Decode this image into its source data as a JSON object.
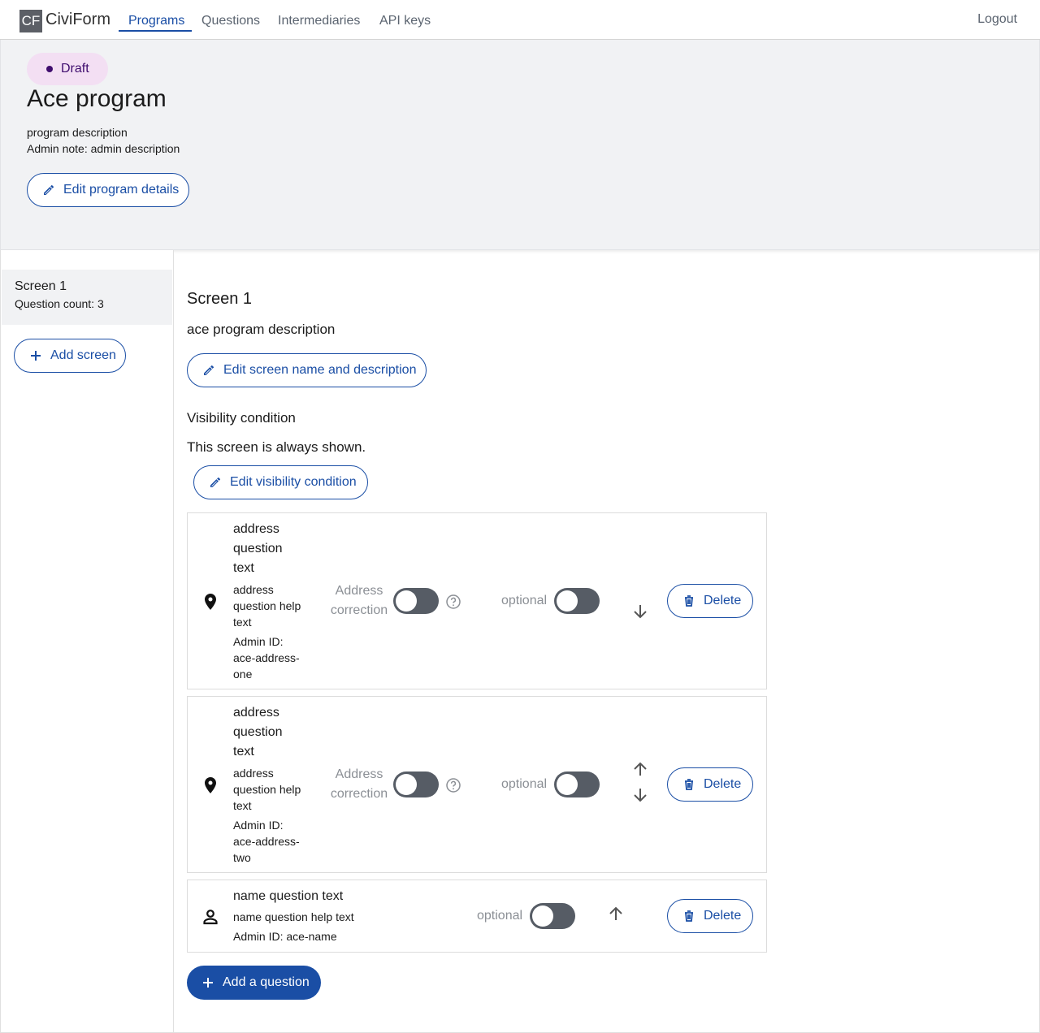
{
  "nav": {
    "logo_abbr": "CF",
    "brand": "CiviForm",
    "links": [
      "Programs",
      "Questions",
      "Intermediaries",
      "API keys"
    ],
    "active": "Programs",
    "logout": "Logout"
  },
  "program": {
    "status": "Draft",
    "title": "Ace program",
    "description": "program description",
    "admin_note": "Admin note: admin description",
    "edit_button": "Edit program details"
  },
  "sidebar": {
    "screens": [
      {
        "title": "Screen 1",
        "count": "Question count: 3"
      }
    ],
    "add_screen": "Add screen"
  },
  "screen": {
    "title": "Screen 1",
    "description": "ace program description",
    "edit_button": "Edit screen name and description",
    "visibility_title": "Visibility condition",
    "visibility_text": "This screen is always shown.",
    "edit_visibility_button": "Edit visibility condition"
  },
  "questions": [
    {
      "icon": "location-pin-icon",
      "text_lines": [
        "address",
        "question",
        "text"
      ],
      "help_lines": [
        "address",
        "question help",
        "text"
      ],
      "admin_lines": [
        "Admin ID:",
        "ace-address-",
        "one"
      ],
      "address_correction": [
        "Address",
        "correction"
      ],
      "optional": "optional",
      "delete": "Delete",
      "arrows": [
        "down"
      ]
    },
    {
      "icon": "location-pin-icon",
      "text_lines": [
        "address",
        "question",
        "text"
      ],
      "help_lines": [
        "address",
        "question help",
        "text"
      ],
      "admin_lines": [
        "Admin ID:",
        "ace-address-",
        "two"
      ],
      "address_correction": [
        "Address",
        "correction"
      ],
      "optional": "optional",
      "delete": "Delete",
      "arrows": [
        "up",
        "down"
      ]
    },
    {
      "icon": "person-icon",
      "text": "name question text",
      "help": "name question help text",
      "admin": "Admin ID: ace-name",
      "optional": "optional",
      "delete": "Delete",
      "arrows": [
        "up"
      ]
    }
  ],
  "add_question": "Add a question",
  "colors": {
    "primary": "#1a4ea5",
    "toggle_off": "#565c65",
    "draft_badge_bg": "#f3dff3",
    "draft_badge_text": "#3f0d6e",
    "header_bg": "#f1f2f4"
  }
}
